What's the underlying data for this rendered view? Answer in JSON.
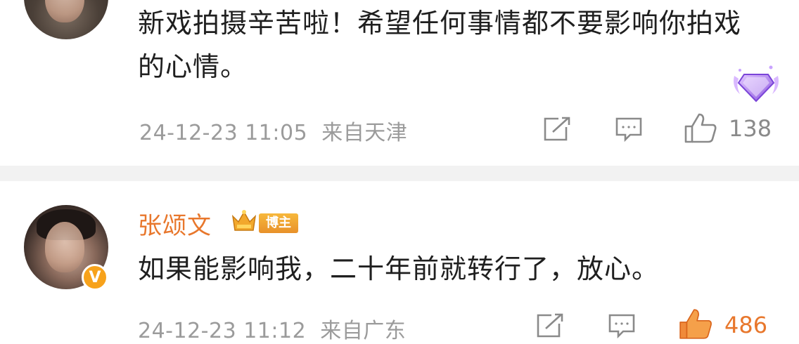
{
  "comments": [
    {
      "text": "新戏拍摄辛苦啦！希望任何事情都不要影响你拍戏的心情。",
      "timestamp": "24-12-23 11:05",
      "location": "来自天津",
      "likes": "138",
      "liked": false,
      "badge_icon": "diamond-fan-badge-icon"
    },
    {
      "username": "张颂文",
      "role_badge": "博主",
      "text": "如果能影响我，二十年前就转行了，放心。",
      "timestamp": "24-12-23 11:12",
      "location": "来自广东",
      "likes": "486",
      "liked": true,
      "verified_icon": "V"
    }
  ],
  "colors": {
    "accent_orange": "#e8772c",
    "meta_gray": "#9b9b9b",
    "divider": "#f2f2f2",
    "badge_purple": "#a77be8"
  }
}
